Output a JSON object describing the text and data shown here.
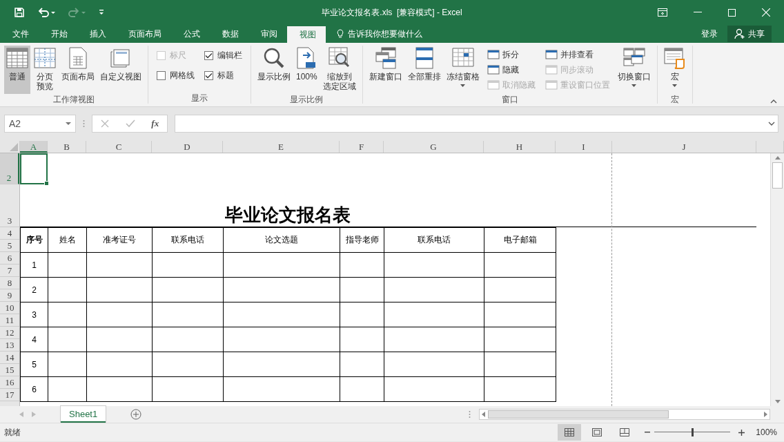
{
  "window": {
    "title": "毕业论文报名表.xls  [兼容模式] - Excel"
  },
  "menu_tabs": [
    {
      "label": "文件",
      "selected": false
    },
    {
      "label": "开始",
      "selected": false
    },
    {
      "label": "插入",
      "selected": false
    },
    {
      "label": "页面布局",
      "selected": false
    },
    {
      "label": "公式",
      "selected": false
    },
    {
      "label": "数据",
      "selected": false
    },
    {
      "label": "审阅",
      "selected": false
    },
    {
      "label": "视图",
      "selected": true
    }
  ],
  "tell_me": "告诉我你想要做什么",
  "account": {
    "sign_in": "登录",
    "share": "共享"
  },
  "ribbon_groups": [
    {
      "label": "工作簿视图",
      "controls": [
        {
          "kind": "large",
          "label": "普通",
          "selected": true
        },
        {
          "kind": "large",
          "lines": [
            "分页",
            "预览"
          ],
          "selected": false
        },
        {
          "kind": "large",
          "label": "页面布局",
          "selected": false
        },
        {
          "kind": "large",
          "label": "自定义视图",
          "selected": false
        }
      ]
    },
    {
      "label": "显示",
      "controls": [
        {
          "kind": "checkbox",
          "label": "标尺",
          "checked": false,
          "disabled": true
        },
        {
          "kind": "checkbox",
          "label": "网格线",
          "checked": false,
          "disabled": false
        },
        {
          "kind": "checkbox",
          "label": "编辑栏",
          "checked": true,
          "disabled": false
        },
        {
          "kind": "checkbox",
          "label": "标题",
          "checked": true,
          "disabled": false
        }
      ]
    },
    {
      "label": "显示比例",
      "controls": [
        {
          "kind": "large",
          "label": "显示比例",
          "selected": false
        },
        {
          "kind": "large",
          "label": "100%",
          "selected": false
        },
        {
          "kind": "large",
          "lines": [
            "缩放到",
            "选定区域"
          ],
          "selected": false
        }
      ]
    },
    {
      "label": "窗口",
      "controls": [
        {
          "kind": "large",
          "label": "新建窗口",
          "selected": false
        },
        {
          "kind": "large",
          "label": "全部重排",
          "selected": false
        },
        {
          "kind": "large",
          "label": "冻结窗格",
          "selected": false,
          "dropdown": true
        },
        {
          "kind": "small",
          "label": "拆分",
          "disabled": false
        },
        {
          "kind": "small",
          "label": "隐藏",
          "disabled": false
        },
        {
          "kind": "small",
          "label": "取消隐藏",
          "disabled": true
        },
        {
          "kind": "small",
          "label": "并排查看",
          "disabled": false
        },
        {
          "kind": "small",
          "label": "同步滚动",
          "disabled": true
        },
        {
          "kind": "small",
          "label": "重设窗口位置",
          "disabled": true
        },
        {
          "kind": "large",
          "label": "切换窗口",
          "selected": false,
          "dropdown": true
        }
      ]
    },
    {
      "label": "宏",
      "controls": [
        {
          "kind": "large",
          "label": "宏",
          "selected": false,
          "dropdown": true
        }
      ]
    }
  ],
  "name_box": "A2",
  "function_label": "fx",
  "columns": [
    {
      "label": "A",
      "selected": true
    },
    {
      "label": "B",
      "selected": false
    },
    {
      "label": "C",
      "selected": false
    },
    {
      "label": "D",
      "selected": false
    },
    {
      "label": "E",
      "selected": false
    },
    {
      "label": "F",
      "selected": false
    },
    {
      "label": "G",
      "selected": false
    },
    {
      "label": "H",
      "selected": false
    },
    {
      "label": "I",
      "selected": false
    },
    {
      "label": "J",
      "selected": false
    }
  ],
  "rows": [
    {
      "label": "2",
      "selected": true
    },
    {
      "label": "3",
      "selected": false
    },
    {
      "label": "4",
      "selected": false
    },
    {
      "label": "5",
      "selected": false
    },
    {
      "label": "6",
      "selected": false
    },
    {
      "label": "7",
      "selected": false
    },
    {
      "label": "8",
      "selected": false
    },
    {
      "label": "9",
      "selected": false
    },
    {
      "label": "10",
      "selected": false
    },
    {
      "label": "11",
      "selected": false
    },
    {
      "label": "12",
      "selected": false
    },
    {
      "label": "13",
      "selected": false
    },
    {
      "label": "14",
      "selected": false
    },
    {
      "label": "15",
      "selected": false
    },
    {
      "label": "16",
      "selected": false
    },
    {
      "label": "17",
      "selected": false
    }
  ],
  "sheet": {
    "title": "毕业论文报名表",
    "headers": [
      "序号",
      "姓名",
      "准考证号",
      "联系电话",
      "论文选题",
      "指导老师",
      "联系电话",
      "电子邮箱"
    ],
    "rows": [
      "1",
      "2",
      "3",
      "4",
      "5",
      "6"
    ]
  },
  "sheet_tabs": [
    {
      "label": "Sheet1",
      "selected": true
    }
  ],
  "status": "就绪",
  "view_buttons": [
    {
      "selected": true
    },
    {
      "selected": false
    },
    {
      "selected": false
    }
  ],
  "zoom": {
    "level": 0.5,
    "reading": "100%"
  }
}
